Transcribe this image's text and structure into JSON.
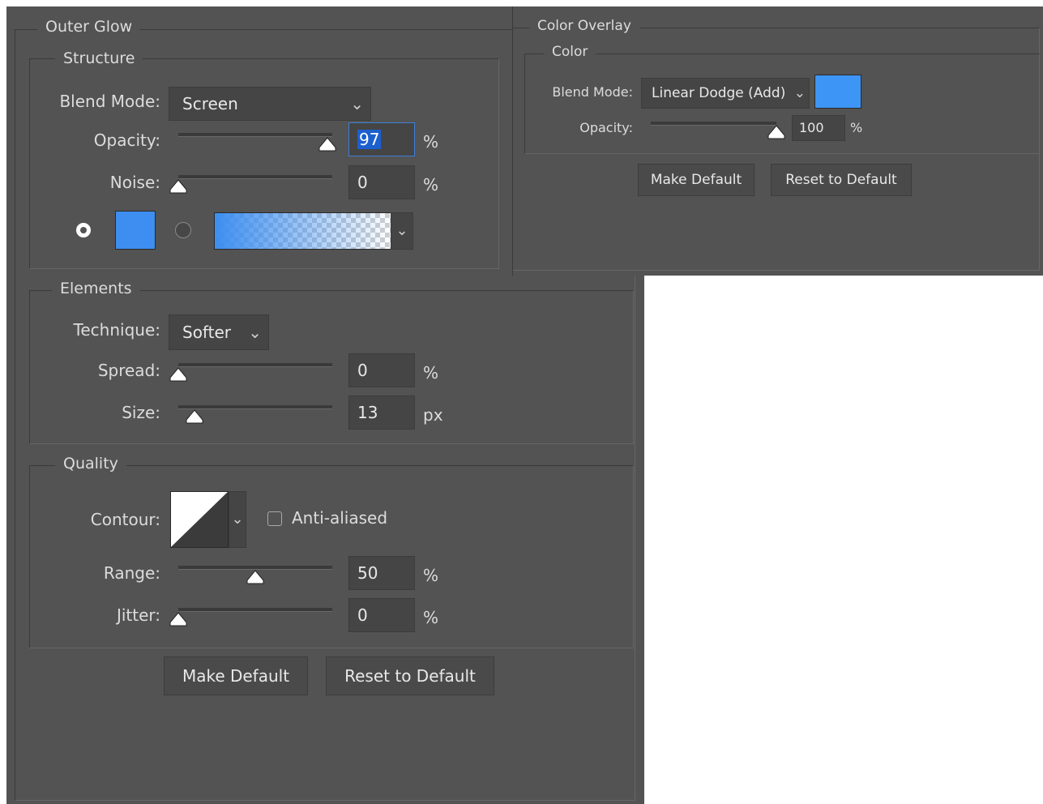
{
  "outer_glow": {
    "title": "Outer Glow",
    "structure": {
      "legend": "Structure",
      "blend_mode_label": "Blend Mode:",
      "blend_mode_value": "Screen",
      "opacity_label": "Opacity:",
      "opacity_value": "97",
      "opacity_level": 0.97,
      "noise_label": "Noise:",
      "noise_value": "0",
      "noise_level": 0.0,
      "percent": "%",
      "glow_color": "#3d8ef0"
    },
    "elements": {
      "legend": "Elements",
      "technique_label": "Technique:",
      "technique_value": "Softer",
      "spread_label": "Spread:",
      "spread_value": "0",
      "spread_level": 0.0,
      "size_label": "Size:",
      "size_value": "13",
      "size_unit": "px",
      "size_level": 0.05,
      "percent": "%"
    },
    "quality": {
      "legend": "Quality",
      "contour_label": "Contour:",
      "anti_aliased_label": "Anti-aliased",
      "anti_aliased_checked": false,
      "range_label": "Range:",
      "range_value": "50",
      "range_level": 0.5,
      "jitter_label": "Jitter:",
      "jitter_value": "0",
      "jitter_level": 0.0,
      "percent": "%"
    },
    "make_default": "Make Default",
    "reset_default": "Reset to Default"
  },
  "color_overlay": {
    "title": "Color Overlay",
    "color_legend": "Color",
    "blend_mode_label": "Blend Mode:",
    "blend_mode_value": "Linear Dodge (Add)",
    "overlay_color": "#3d95f5",
    "opacity_label": "Opacity:",
    "opacity_value": "100",
    "opacity_level": 1.0,
    "percent": "%",
    "make_default": "Make Default",
    "reset_default": "Reset to Default"
  },
  "icons": {
    "caret": "⌄"
  }
}
